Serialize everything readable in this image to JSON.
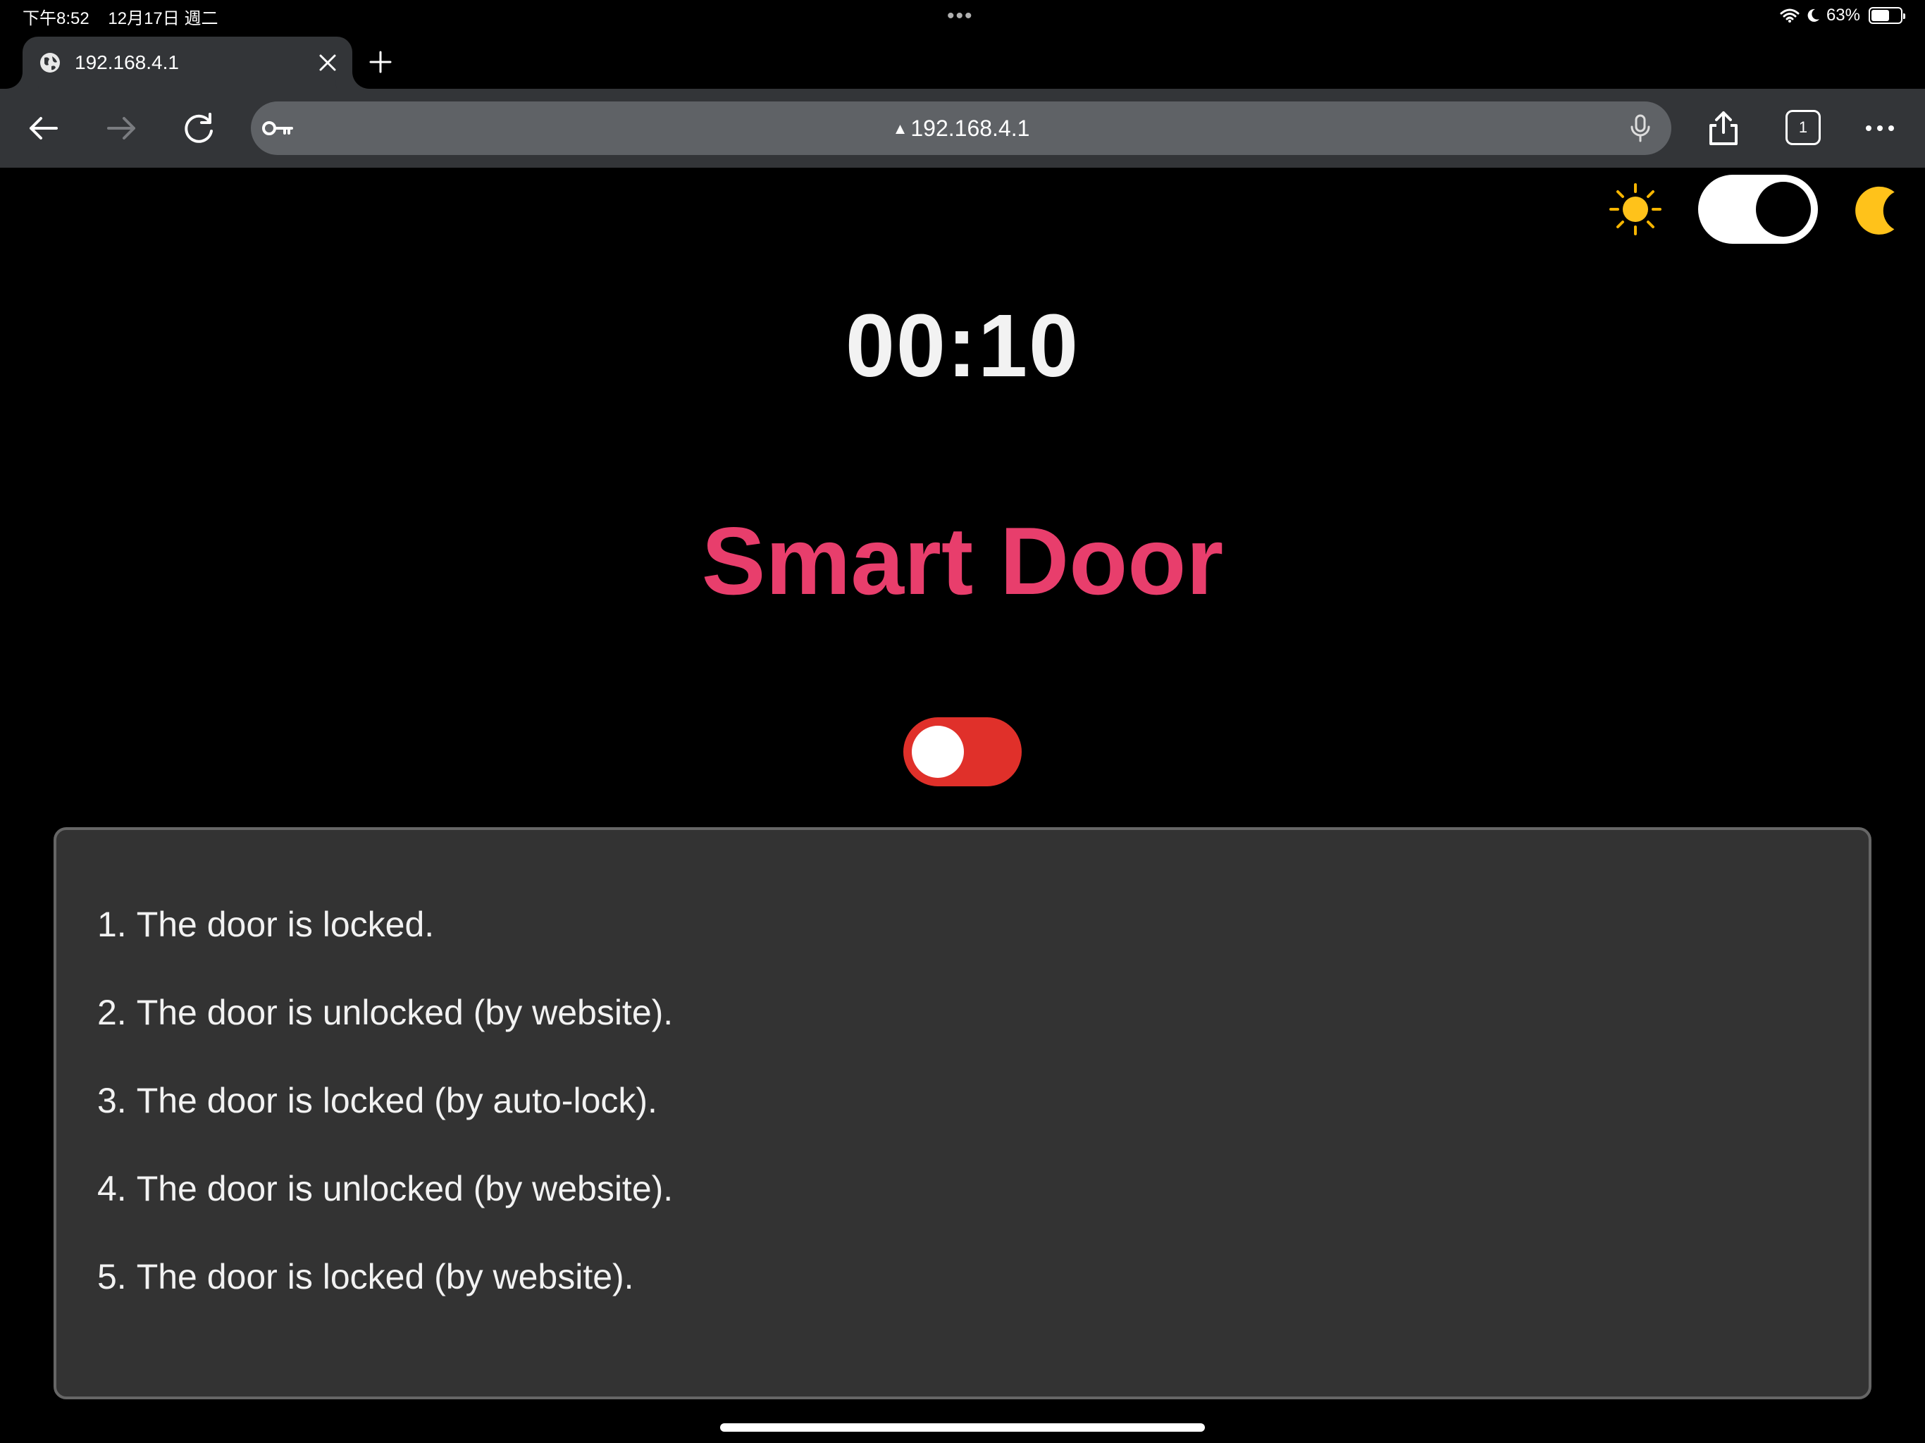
{
  "status_bar": {
    "time": "下午8:52",
    "date": "12月17日 週二",
    "battery_percent": "63%",
    "battery_level": 0.63
  },
  "browser": {
    "tab_title": "192.168.4.1",
    "url": "192.168.4.1",
    "tab_count": "1"
  },
  "page": {
    "theme_dark_mode_on": true,
    "timer": "00:10",
    "title": "Smart Door",
    "title_color": "#e83e6c",
    "lock_switch_color": "#e0302a",
    "lock_switch_on": false,
    "log": [
      {
        "num": "1.",
        "text": "The door is locked."
      },
      {
        "num": "2.",
        "text": "The door is unlocked (by website)."
      },
      {
        "num": "3.",
        "text": "The door is locked (by auto-lock)."
      },
      {
        "num": "4.",
        "text": "The door is unlocked (by website)."
      },
      {
        "num": "5.",
        "text": "The door is locked (by website)."
      }
    ]
  }
}
